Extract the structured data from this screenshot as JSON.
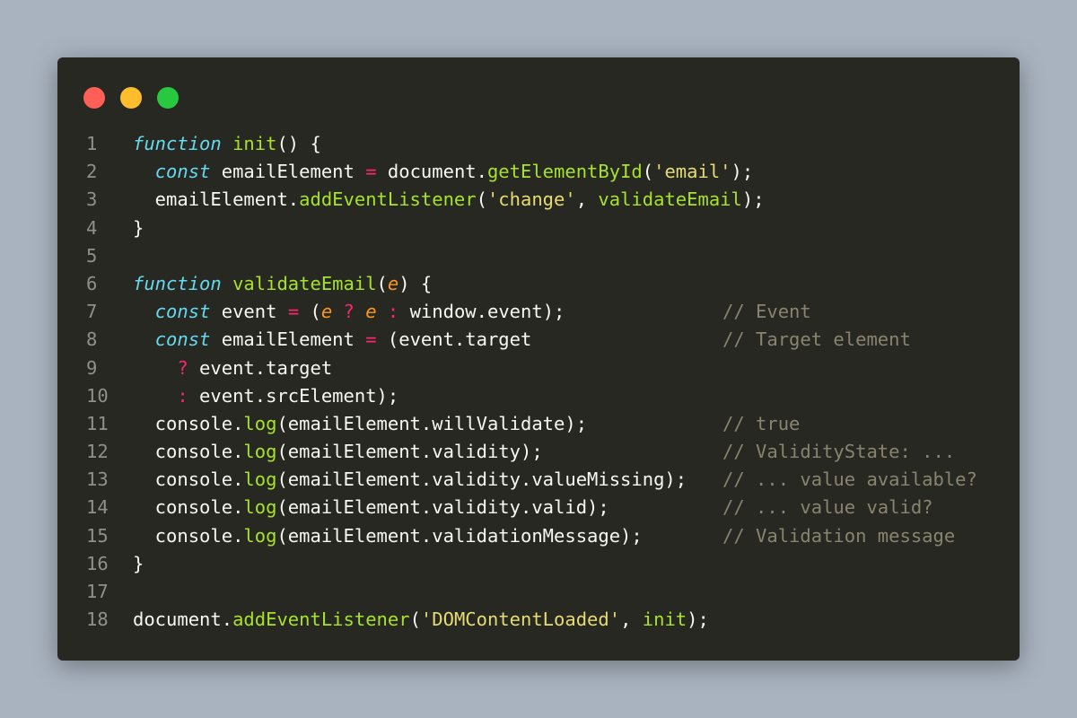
{
  "window": {
    "buttons": [
      {
        "name": "close",
        "color": "#ff5f56"
      },
      {
        "name": "minimize",
        "color": "#ffbd2e"
      },
      {
        "name": "maximize",
        "color": "#27c93f"
      }
    ]
  },
  "code": {
    "lines": [
      {
        "num": "1",
        "tokens": [
          {
            "t": "kw",
            "v": "function"
          },
          {
            "t": "pl",
            "v": " "
          },
          {
            "t": "fn",
            "v": "init"
          },
          {
            "t": "pl",
            "v": "() {"
          }
        ]
      },
      {
        "num": "2",
        "tokens": [
          {
            "t": "pl",
            "v": "  "
          },
          {
            "t": "kw",
            "v": "const"
          },
          {
            "t": "pl",
            "v": " emailElement "
          },
          {
            "t": "op",
            "v": "="
          },
          {
            "t": "pl",
            "v": " document."
          },
          {
            "t": "fn",
            "v": "getElementById"
          },
          {
            "t": "pl",
            "v": "("
          },
          {
            "t": "str",
            "v": "'email'"
          },
          {
            "t": "pl",
            "v": ");"
          }
        ]
      },
      {
        "num": "3",
        "tokens": [
          {
            "t": "pl",
            "v": "  emailElement."
          },
          {
            "t": "fn",
            "v": "addEventListener"
          },
          {
            "t": "pl",
            "v": "("
          },
          {
            "t": "str",
            "v": "'change'"
          },
          {
            "t": "pl",
            "v": ", "
          },
          {
            "t": "fn",
            "v": "validateEmail"
          },
          {
            "t": "pl",
            "v": ");"
          }
        ]
      },
      {
        "num": "4",
        "tokens": [
          {
            "t": "pl",
            "v": "}"
          }
        ]
      },
      {
        "num": "5",
        "tokens": []
      },
      {
        "num": "6",
        "tokens": [
          {
            "t": "kw",
            "v": "function"
          },
          {
            "t": "pl",
            "v": " "
          },
          {
            "t": "fn",
            "v": "validateEmail"
          },
          {
            "t": "pl",
            "v": "("
          },
          {
            "t": "pm",
            "v": "e"
          },
          {
            "t": "pl",
            "v": ") {"
          }
        ]
      },
      {
        "num": "7",
        "tokens": [
          {
            "t": "pl",
            "v": "  "
          },
          {
            "t": "kw",
            "v": "const"
          },
          {
            "t": "pl",
            "v": " event "
          },
          {
            "t": "op",
            "v": "="
          },
          {
            "t": "pl",
            "v": " ("
          },
          {
            "t": "pm",
            "v": "e"
          },
          {
            "t": "pl",
            "v": " "
          },
          {
            "t": "op",
            "v": "?"
          },
          {
            "t": "pl",
            "v": " "
          },
          {
            "t": "pm",
            "v": "e"
          },
          {
            "t": "pl",
            "v": " "
          },
          {
            "t": "op",
            "v": ":"
          },
          {
            "t": "pl",
            "v": " window.event);"
          }
        ],
        "comment": "// Event"
      },
      {
        "num": "8",
        "tokens": [
          {
            "t": "pl",
            "v": "  "
          },
          {
            "t": "kw",
            "v": "const"
          },
          {
            "t": "pl",
            "v": " emailElement "
          },
          {
            "t": "op",
            "v": "="
          },
          {
            "t": "pl",
            "v": " (event.target"
          }
        ],
        "comment": "// Target element"
      },
      {
        "num": "9",
        "tokens": [
          {
            "t": "pl",
            "v": "    "
          },
          {
            "t": "op",
            "v": "?"
          },
          {
            "t": "pl",
            "v": " event.target"
          }
        ]
      },
      {
        "num": "10",
        "tokens": [
          {
            "t": "pl",
            "v": "    "
          },
          {
            "t": "op",
            "v": ":"
          },
          {
            "t": "pl",
            "v": " event.srcElement);"
          }
        ]
      },
      {
        "num": "11",
        "tokens": [
          {
            "t": "pl",
            "v": "  console."
          },
          {
            "t": "fn",
            "v": "log"
          },
          {
            "t": "pl",
            "v": "(emailElement.willValidate);"
          }
        ],
        "comment": "// true"
      },
      {
        "num": "12",
        "tokens": [
          {
            "t": "pl",
            "v": "  console."
          },
          {
            "t": "fn",
            "v": "log"
          },
          {
            "t": "pl",
            "v": "(emailElement.validity);"
          }
        ],
        "comment": "// ValidityState: ..."
      },
      {
        "num": "13",
        "tokens": [
          {
            "t": "pl",
            "v": "  console."
          },
          {
            "t": "fn",
            "v": "log"
          },
          {
            "t": "pl",
            "v": "(emailElement.validity.valueMissing);"
          }
        ],
        "comment": "// ... value available?"
      },
      {
        "num": "14",
        "tokens": [
          {
            "t": "pl",
            "v": "  console."
          },
          {
            "t": "fn",
            "v": "log"
          },
          {
            "t": "pl",
            "v": "(emailElement.validity.valid);"
          }
        ],
        "comment": "// ... value valid?"
      },
      {
        "num": "15",
        "tokens": [
          {
            "t": "pl",
            "v": "  console."
          },
          {
            "t": "fn",
            "v": "log"
          },
          {
            "t": "pl",
            "v": "(emailElement.validationMessage);"
          }
        ],
        "comment": "// Validation message"
      },
      {
        "num": "16",
        "tokens": [
          {
            "t": "pl",
            "v": "}"
          }
        ]
      },
      {
        "num": "17",
        "tokens": []
      },
      {
        "num": "18",
        "tokens": [
          {
            "t": "pl",
            "v": "document."
          },
          {
            "t": "fn",
            "v": "addEventListener"
          },
          {
            "t": "pl",
            "v": "("
          },
          {
            "t": "str",
            "v": "'DOMContentLoaded'"
          },
          {
            "t": "pl",
            "v": ", "
          },
          {
            "t": "fn",
            "v": "init"
          },
          {
            "t": "pl",
            "v": ");"
          }
        ]
      }
    ]
  }
}
